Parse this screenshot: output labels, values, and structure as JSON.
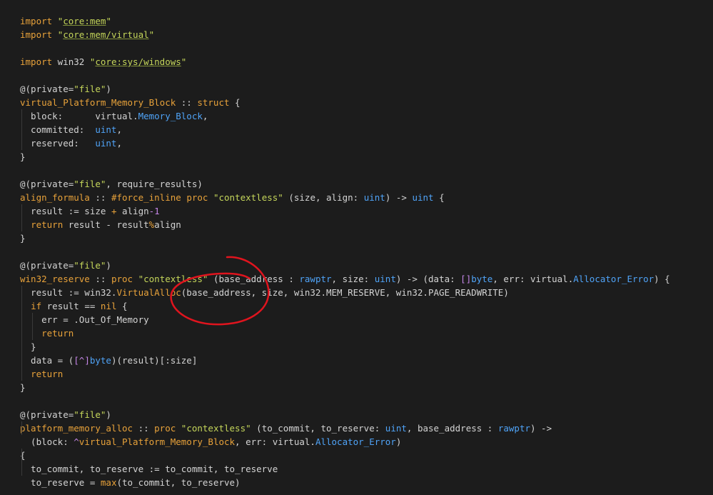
{
  "code_lines": [
    [
      {
        "t": "import",
        "c": "kw"
      },
      {
        "t": " "
      },
      {
        "t": "\"",
        "c": "str"
      },
      {
        "t": "core:mem",
        "c": "ustr"
      },
      {
        "t": "\"",
        "c": "str"
      }
    ],
    [
      {
        "t": "import",
        "c": "kw"
      },
      {
        "t": " "
      },
      {
        "t": "\"",
        "c": "str"
      },
      {
        "t": "core:mem/virtual",
        "c": "ustr"
      },
      {
        "t": "\"",
        "c": "str"
      }
    ],
    [],
    [
      {
        "t": "import",
        "c": "kw"
      },
      {
        "t": " win32 "
      },
      {
        "t": "\"",
        "c": "str"
      },
      {
        "t": "core:sys/windows",
        "c": "ustr"
      },
      {
        "t": "\"",
        "c": "str"
      }
    ],
    [],
    [
      {
        "t": "@(private=",
        "c": "attr"
      },
      {
        "t": "\"file\"",
        "c": "str"
      },
      {
        "t": ")",
        "c": "attr"
      }
    ],
    [
      {
        "t": "virtual_Platform_Memory_Block",
        "c": "fn"
      },
      {
        "t": " :: "
      },
      {
        "t": "struct",
        "c": "kw"
      },
      {
        "t": " {"
      }
    ],
    [
      {
        "t": "  block:      virtual."
      },
      {
        "t": "Memory_Block",
        "c": "type"
      },
      {
        "t": ","
      }
    ],
    [
      {
        "t": "  committed:  "
      },
      {
        "t": "uint",
        "c": "type"
      },
      {
        "t": ","
      }
    ],
    [
      {
        "t": "  reserved:   "
      },
      {
        "t": "uint",
        "c": "type"
      },
      {
        "t": ","
      }
    ],
    [
      {
        "t": "}"
      }
    ],
    [],
    [
      {
        "t": "@(private=",
        "c": "attr"
      },
      {
        "t": "\"file\"",
        "c": "str"
      },
      {
        "t": ", require_results)",
        "c": "attr"
      }
    ],
    [
      {
        "t": "align_formula",
        "c": "fn"
      },
      {
        "t": " :: "
      },
      {
        "t": "#force_inline",
        "c": "kw"
      },
      {
        "t": " "
      },
      {
        "t": "proc",
        "c": "kw"
      },
      {
        "t": " "
      },
      {
        "t": "\"contextless\"",
        "c": "str"
      },
      {
        "t": " (size, align: "
      },
      {
        "t": "uint",
        "c": "type"
      },
      {
        "t": ") -> "
      },
      {
        "t": "uint",
        "c": "type"
      },
      {
        "t": " {"
      }
    ],
    [
      {
        "t": "  result := size "
      },
      {
        "t": "+",
        "c": "op"
      },
      {
        "t": " align"
      },
      {
        "t": "-1",
        "c": "num"
      }
    ],
    [
      {
        "t": "  "
      },
      {
        "t": "return",
        "c": "kw"
      },
      {
        "t": " result - result"
      },
      {
        "t": "%",
        "c": "op"
      },
      {
        "t": "align"
      }
    ],
    [
      {
        "t": "}"
      }
    ],
    [],
    [
      {
        "t": "@(private=",
        "c": "attr"
      },
      {
        "t": "\"file\"",
        "c": "str"
      },
      {
        "t": ")",
        "c": "attr"
      }
    ],
    [
      {
        "t": "win32_reserve",
        "c": "fn"
      },
      {
        "t": " :: "
      },
      {
        "t": "proc",
        "c": "kw"
      },
      {
        "t": " "
      },
      {
        "t": "\"contextless\"",
        "c": "str"
      },
      {
        "t": " (base_address : "
      },
      {
        "t": "rawptr",
        "c": "type"
      },
      {
        "t": ", size: "
      },
      {
        "t": "uint",
        "c": "type"
      },
      {
        "t": ") -> (data: "
      },
      {
        "t": "[]",
        "c": "num"
      },
      {
        "t": "byte",
        "c": "type"
      },
      {
        "t": ", err: virtual."
      },
      {
        "t": "Allocator_Error",
        "c": "type"
      },
      {
        "t": ") {"
      }
    ],
    [
      {
        "t": "  result := win32."
      },
      {
        "t": "VirtualAlloc",
        "c": "fn"
      },
      {
        "t": "(base_address, size, win32.MEM_RESERVE, win32.PAGE_READWRITE)"
      }
    ],
    [
      {
        "t": "  "
      },
      {
        "t": "if",
        "c": "kw"
      },
      {
        "t": " result == "
      },
      {
        "t": "nil",
        "c": "kw"
      },
      {
        "t": " {"
      }
    ],
    [
      {
        "t": "    err = .Out_Of_Memory"
      }
    ],
    [
      {
        "t": "    "
      },
      {
        "t": "return",
        "c": "kw"
      }
    ],
    [
      {
        "t": "  }"
      }
    ],
    [
      {
        "t": "  data = ("
      },
      {
        "t": "[^]",
        "c": "num"
      },
      {
        "t": "byte",
        "c": "type"
      },
      {
        "t": ")(result)[:size]"
      }
    ],
    [
      {
        "t": "  "
      },
      {
        "t": "return",
        "c": "kw"
      }
    ],
    [
      {
        "t": "}"
      }
    ],
    [],
    [
      {
        "t": "@(private=",
        "c": "attr"
      },
      {
        "t": "\"file\"",
        "c": "str"
      },
      {
        "t": ")",
        "c": "attr"
      }
    ],
    [
      {
        "t": "platform_memory_alloc",
        "c": "fn"
      },
      {
        "t": " :: "
      },
      {
        "t": "proc",
        "c": "kw"
      },
      {
        "t": " "
      },
      {
        "t": "\"contextless\"",
        "c": "str"
      },
      {
        "t": " (to_commit, to_reserve: "
      },
      {
        "t": "uint",
        "c": "type"
      },
      {
        "t": ", base_address : "
      },
      {
        "t": "rawptr",
        "c": "type"
      },
      {
        "t": ") ->"
      }
    ],
    [
      {
        "t": "  (block: "
      },
      {
        "t": "^",
        "c": "num"
      },
      {
        "t": "virtual_Platform_Memory_Block",
        "c": "fn"
      },
      {
        "t": ", err: virtual."
      },
      {
        "t": "Allocator_Error",
        "c": "type"
      },
      {
        "t": ")"
      }
    ],
    [
      {
        "t": "{"
      }
    ],
    [
      {
        "t": "  to_commit, to_reserve := to_commit, to_reserve"
      }
    ],
    [
      {
        "t": "  to_reserve = "
      },
      {
        "t": "max",
        "c": "fn"
      },
      {
        "t": "(to_commit, to_reserve)"
      }
    ]
  ],
  "colors": {
    "background": "#1c1c1c",
    "keyword": "#e8a23a",
    "string": "#c5d65a",
    "type": "#4fa3f7",
    "annotation": "#e0141e"
  }
}
